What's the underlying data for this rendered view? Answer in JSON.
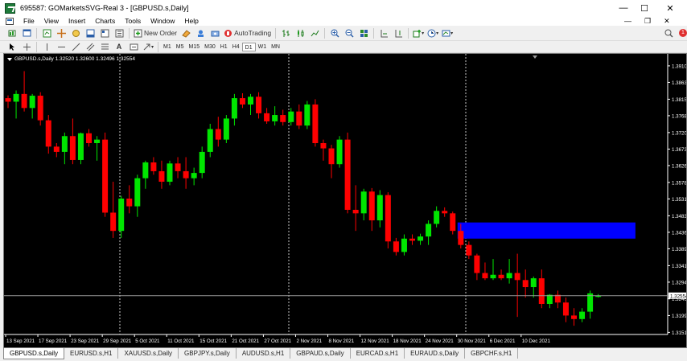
{
  "window": {
    "title": "695587: GOMarketsSVG-Real 3 - [GBPUSD.s,Daily]",
    "minimize": "—",
    "maximize": "☐",
    "close": "✕"
  },
  "menu": {
    "items": [
      "File",
      "View",
      "Insert",
      "Charts",
      "Tools",
      "Window",
      "Help"
    ],
    "notification_count": "1"
  },
  "toolbar": {
    "new_order_label": "New Order",
    "autotrading_label": "AutoTrading",
    "timeframes": [
      "M1",
      "M5",
      "M15",
      "M30",
      "H1",
      "H4",
      "D1",
      "W1",
      "MN"
    ]
  },
  "chart": {
    "header": "GBPUSD.s,Daily  1.32520 1.32600 1.32496 1.32554",
    "current_price_label": "1.32554",
    "colors": {
      "background": "#000000",
      "bull": "#00e600",
      "bear": "#ff0000",
      "zone": "#0000ff",
      "axis_text": "#ffffff",
      "separator": "#c8c8c8"
    }
  },
  "chart_data": {
    "type": "candlestick",
    "symbol": "GBPUSD.s",
    "timeframe": "Daily",
    "ylim": [
      1.3145,
      1.3935
    ],
    "ticks": [
      "1.39100",
      "1.38630",
      "1.38150",
      "1.37680",
      "1.37200",
      "1.36730",
      "1.36260",
      "1.35780",
      "1.35310",
      "1.34830",
      "1.34360",
      "1.33890",
      "1.33410",
      "1.32940",
      "1.32464",
      "1.31990",
      "1.31510"
    ],
    "x_labels": [
      "13 Sep 2021",
      "17 Sep 2021",
      "23 Sep 2021",
      "29 Sep 2021",
      "5 Oct 2021",
      "11 Oct 2021",
      "15 Oct 2021",
      "21 Oct 2021",
      "27 Oct 2021",
      "2 Nov 2021",
      "8 Nov 2021",
      "12 Nov 2021",
      "18 Nov 2021",
      "24 Nov 2021",
      "30 Nov 2021",
      "6 Dec 2021",
      "10 Dec 2021"
    ],
    "current_price": 1.32554,
    "zone": {
      "top": 1.3464,
      "bottom": 1.3418
    },
    "candles": [
      [
        1.3818,
        1.3826,
        1.379,
        1.3808
      ],
      [
        1.3808,
        1.384,
        1.376,
        1.383
      ],
      [
        1.383,
        1.3895,
        1.378,
        1.379
      ],
      [
        1.379,
        1.383,
        1.376,
        1.3825
      ],
      [
        1.3825,
        1.3835,
        1.374,
        1.3755
      ],
      [
        1.3755,
        1.377,
        1.366,
        1.368
      ],
      [
        1.368,
        1.369,
        1.365,
        1.3665
      ],
      [
        1.3665,
        1.372,
        1.363,
        1.371
      ],
      [
        1.371,
        1.376,
        1.363,
        1.3642
      ],
      [
        1.3642,
        1.372,
        1.363,
        1.3718
      ],
      [
        1.3718,
        1.373,
        1.368,
        1.369
      ],
      [
        1.369,
        1.371,
        1.364,
        1.37
      ],
      [
        1.37,
        1.372,
        1.348,
        1.3492
      ],
      [
        1.3492,
        1.358,
        1.342,
        1.344
      ],
      [
        1.344,
        1.354,
        1.342,
        1.3532
      ],
      [
        1.3532,
        1.357,
        1.349,
        1.351
      ],
      [
        1.351,
        1.36,
        1.348,
        1.359
      ],
      [
        1.359,
        1.364,
        1.356,
        1.3635
      ],
      [
        1.3635,
        1.365,
        1.36,
        1.361
      ],
      [
        1.361,
        1.364,
        1.356,
        1.358
      ],
      [
        1.358,
        1.364,
        1.357,
        1.3632
      ],
      [
        1.3632,
        1.365,
        1.359,
        1.361
      ],
      [
        1.361,
        1.365,
        1.356,
        1.359
      ],
      [
        1.359,
        1.362,
        1.357,
        1.3605
      ],
      [
        1.3605,
        1.368,
        1.359,
        1.3665
      ],
      [
        1.3665,
        1.3745,
        1.365,
        1.373
      ],
      [
        1.373,
        1.3765,
        1.368,
        1.37
      ],
      [
        1.37,
        1.377,
        1.369,
        1.376
      ],
      [
        1.376,
        1.383,
        1.374,
        1.3818
      ],
      [
        1.3818,
        1.3832,
        1.379,
        1.38
      ],
      [
        1.38,
        1.383,
        1.377,
        1.3822
      ],
      [
        1.3822,
        1.3835,
        1.376,
        1.3775
      ],
      [
        1.3775,
        1.379,
        1.3745,
        1.3752
      ],
      [
        1.3752,
        1.3795,
        1.374,
        1.377
      ],
      [
        1.377,
        1.3785,
        1.374,
        1.375
      ],
      [
        1.375,
        1.379,
        1.374,
        1.378
      ],
      [
        1.378,
        1.38,
        1.373,
        1.374
      ],
      [
        1.374,
        1.381,
        1.373,
        1.38
      ],
      [
        1.38,
        1.3815,
        1.368,
        1.369
      ],
      [
        1.369,
        1.37,
        1.364,
        1.3675
      ],
      [
        1.3675,
        1.3685,
        1.359,
        1.363
      ],
      [
        1.363,
        1.371,
        1.362,
        1.37
      ],
      [
        1.37,
        1.372,
        1.349,
        1.35
      ],
      [
        1.35,
        1.357,
        1.344,
        1.349
      ],
      [
        1.349,
        1.356,
        1.347,
        1.3552
      ],
      [
        1.3552,
        1.3562,
        1.344,
        1.347
      ],
      [
        1.347,
        1.3556,
        1.345,
        1.3542
      ],
      [
        1.3542,
        1.355,
        1.339,
        1.341
      ],
      [
        1.341,
        1.342,
        1.337,
        1.338
      ],
      [
        1.338,
        1.343,
        1.337,
        1.3418
      ],
      [
        1.3418,
        1.343,
        1.34,
        1.3412
      ],
      [
        1.3412,
        1.3432,
        1.34,
        1.3424
      ],
      [
        1.3424,
        1.347,
        1.34,
        1.346
      ],
      [
        1.346,
        1.351,
        1.345,
        1.3497
      ],
      [
        1.3497,
        1.3507,
        1.348,
        1.349
      ],
      [
        1.349,
        1.3495,
        1.343,
        1.344
      ],
      [
        1.344,
        1.346,
        1.339,
        1.34
      ],
      [
        1.34,
        1.341,
        1.336,
        1.337
      ],
      [
        1.337,
        1.3375,
        1.33,
        1.332
      ],
      [
        1.332,
        1.335,
        1.33,
        1.3305
      ],
      [
        1.3305,
        1.336,
        1.33,
        1.3315
      ],
      [
        1.3315,
        1.333,
        1.33,
        1.3305
      ],
      [
        1.3305,
        1.336,
        1.329,
        1.332
      ],
      [
        1.332,
        1.3375,
        1.3195,
        1.33
      ],
      [
        1.33,
        1.333,
        1.325,
        1.328
      ],
      [
        1.328,
        1.331,
        1.325,
        1.3305
      ],
      [
        1.3305,
        1.333,
        1.322,
        1.3232
      ],
      [
        1.3232,
        1.326,
        1.322,
        1.3258
      ],
      [
        1.3258,
        1.327,
        1.322,
        1.3236
      ],
      [
        1.3236,
        1.325,
        1.318,
        1.3199
      ],
      [
        1.3199,
        1.322,
        1.317,
        1.3189
      ],
      [
        1.3189,
        1.322,
        1.318,
        1.321
      ],
      [
        1.321,
        1.327,
        1.319,
        1.3262
      ],
      [
        1.3252,
        1.326,
        1.325,
        1.32554
      ]
    ]
  },
  "tabs": [
    "GBPUSD.s,Daily",
    "EURUSD.s,H1",
    "XAUUSD.s,Daily",
    "GBPJPY.s,Daily",
    "AUDUSD.s,H1",
    "GBPAUD.s,Daily",
    "EURCAD.s,H1",
    "EURAUD.s,Daily",
    "GBPCHF.s,H1"
  ]
}
